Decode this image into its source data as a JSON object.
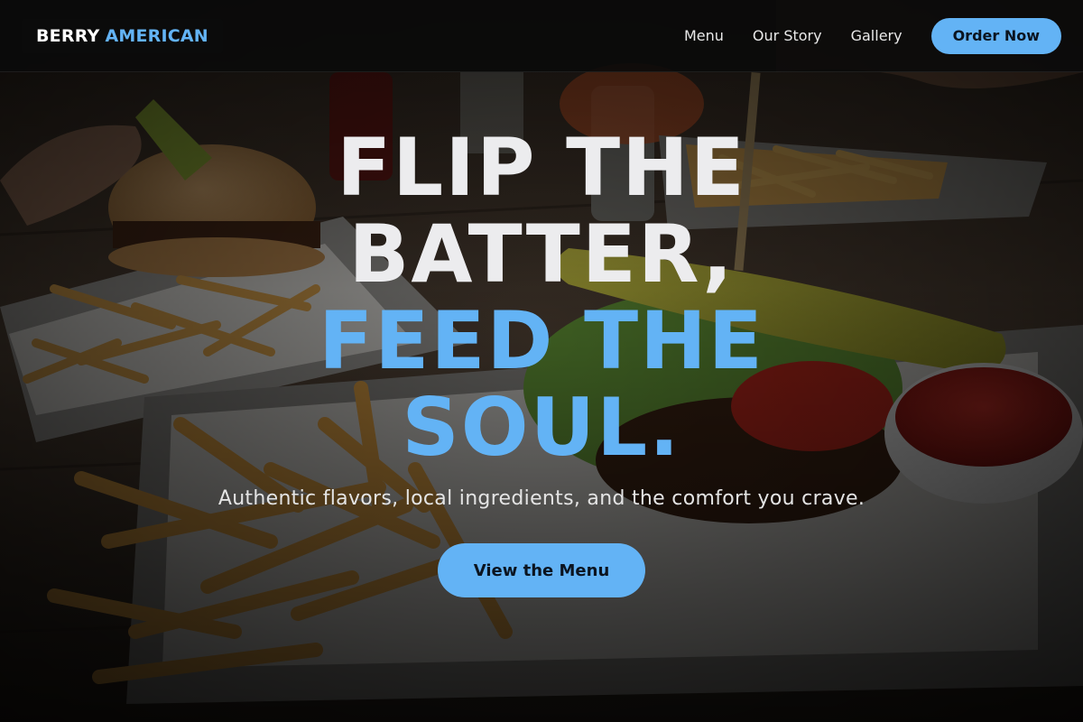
{
  "header": {
    "brand_part1": "BERRY",
    "brand_part2": "AMERICAN",
    "nav": [
      {
        "label": "Menu"
      },
      {
        "label": "Our Story"
      },
      {
        "label": "Gallery"
      }
    ],
    "order_label": "Order Now"
  },
  "hero": {
    "headline_line1": "FLIP THE",
    "headline_line2": "BATTER,",
    "headline_line3": "FEED THE",
    "headline_line4": "SOUL.",
    "subtitle": "Authentic flavors, local ingredients, and the comfort you crave.",
    "cta_label": "View the Menu",
    "background_image": "burger-and-fries-photo"
  },
  "colors": {
    "accent": "#63b3f5",
    "header_bg": "#0a0a0a",
    "headline_white": "#ececee"
  }
}
